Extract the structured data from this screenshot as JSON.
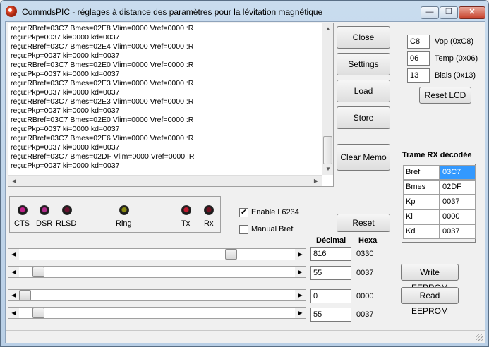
{
  "window": {
    "title": "CommdsPIC - réglages à distance des paramètres pour la lévitation magnétique",
    "minimize": "—",
    "maximize": "❐",
    "close": "✕"
  },
  "memo": {
    "lines": [
      "reçu:RBref=03C7 Bmes=02E8 Vlim=0000 Vref=0000 :R",
      "reçu:Pkp=0037 ki=0000 kd=0037",
      "reçu:RBref=03C7 Bmes=02E4 Vlim=0000 Vref=0000 :R",
      "reçu:Pkp=0037 ki=0000 kd=0037",
      "reçu:RBref=03C7 Bmes=02E0 Vlim=0000 Vref=0000 :R",
      "reçu:Pkp=0037 ki=0000 kd=0037",
      "reçu:RBref=03C7 Bmes=02E3 Vlim=0000 Vref=0000 :R",
      "reçu:Pkp=0037 ki=0000 kd=0037",
      "reçu:RBref=03C7 Bmes=02E3 Vlim=0000 Vref=0000 :R",
      "reçu:Pkp=0037 ki=0000 kd=0037",
      "reçu:RBref=03C7 Bmes=02E0 Vlim=0000 Vref=0000 :R",
      "reçu:Pkp=0037 ki=0000 kd=0037",
      "reçu:RBref=03C7 Bmes=02E6 Vlim=0000 Vref=0000 :R",
      "reçu:Pkp=0037 ki=0000 kd=0037",
      "reçu:RBref=03C7 Bmes=02DF Vlim=0000 Vref=0000 :R",
      "reçu:Pkp=0037 ki=0000 kd=0037"
    ]
  },
  "buttons": {
    "close": "Close",
    "settings": "Settings",
    "load": "Load",
    "store": "Store",
    "clear_memo": "Clear Memo",
    "reset": "Reset",
    "reset_lcd": "Reset LCD",
    "write_eeprom": "Write EEPROM",
    "read_eeprom": "Read EEPROM"
  },
  "lcd": [
    {
      "value": "C8",
      "label": "Vop (0xC8)"
    },
    {
      "value": "06",
      "label": "Temp (0x06)"
    },
    {
      "value": "13",
      "label": "Biais (0x13)"
    }
  ],
  "leds": [
    {
      "label": "CTS",
      "color": "#c0208a"
    },
    {
      "label": "DSR",
      "color": "#b02a8a"
    },
    {
      "label": "RLSD",
      "color": "#6a1030"
    },
    {
      "label": "Ring",
      "color": "#8a8a10"
    },
    {
      "label": "Tx",
      "color": "#c01a30"
    },
    {
      "label": "Rx",
      "color": "#701020"
    }
  ],
  "checks": {
    "enable_l6234": {
      "label": "Enable L6234",
      "checked": true
    },
    "manual_bref": {
      "label": "Manual Bref",
      "checked": false
    }
  },
  "table_headers": {
    "decimal": "Décimal",
    "hexa": "Hexa"
  },
  "sliders": [
    {
      "decimal": "816",
      "hexa": "0330",
      "fraction": 0.78
    },
    {
      "decimal": "55",
      "hexa": "0037",
      "fraction": 0.05
    },
    {
      "decimal": "0",
      "hexa": "0000",
      "fraction": 0.0
    },
    {
      "decimal": "55",
      "hexa": "0037",
      "fraction": 0.05
    }
  ],
  "trame": {
    "title": "Trame RX décodée",
    "rows": [
      {
        "name": "Bref",
        "value": "03C7",
        "selected": true
      },
      {
        "name": "Bmes",
        "value": "02DF",
        "selected": false
      },
      {
        "name": "Kp",
        "value": "0037",
        "selected": false
      },
      {
        "name": "Ki",
        "value": "0000",
        "selected": false
      },
      {
        "name": "Kd",
        "value": "0037",
        "selected": false
      }
    ]
  }
}
